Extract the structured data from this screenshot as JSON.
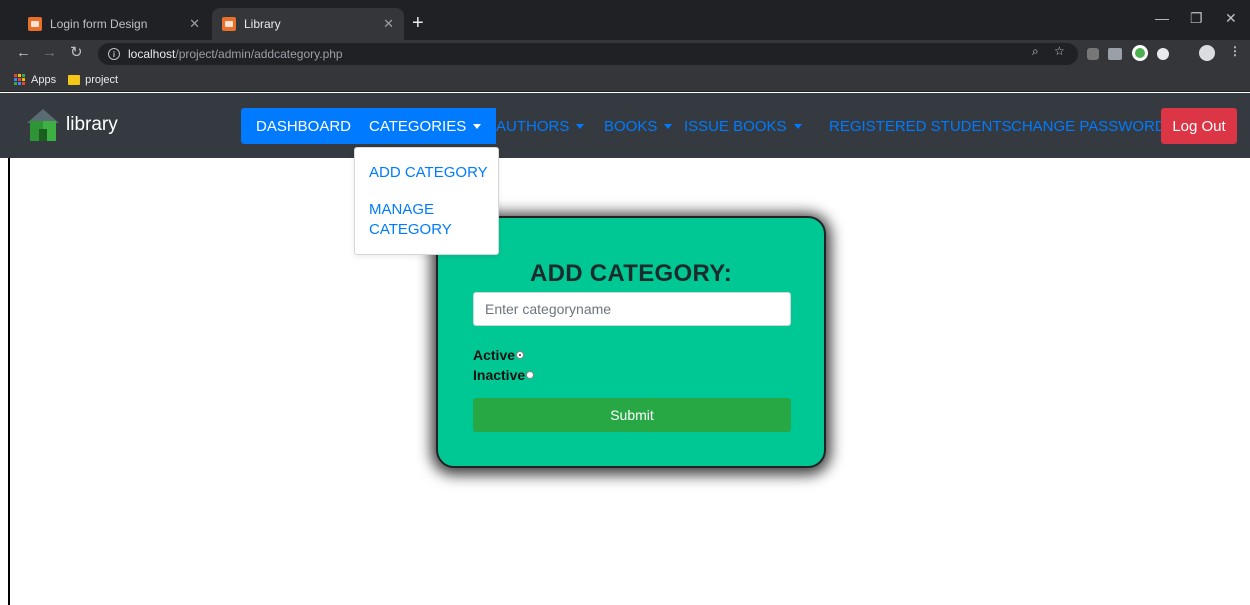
{
  "browser": {
    "tabs": [
      {
        "title": "Login form Design",
        "active": false
      },
      {
        "title": "Library",
        "active": true
      }
    ],
    "new_tab_label": "+",
    "url_host": "localhost",
    "url_path": "/project/admin/addcategory.php",
    "bookmarks": [
      {
        "label": "Apps",
        "icon": "apps-grid-icon"
      },
      {
        "label": "project",
        "icon": "folder-icon"
      }
    ]
  },
  "navbar": {
    "brand": "library",
    "links": [
      {
        "label": "DASHBOARD"
      },
      {
        "label": "CATEGORIES"
      },
      {
        "label": "AUTHORS"
      },
      {
        "label": "BOOKS"
      },
      {
        "label": "ISSUE BOOKS"
      },
      {
        "label": "REGISTERED STUDENTS"
      },
      {
        "label": "CHANGE PASSWORD"
      }
    ],
    "logout": "Log Out"
  },
  "dropdown": {
    "items": [
      "ADD CATEGORY",
      "MANAGE CATEGORY"
    ]
  },
  "form": {
    "title": "ADD CATEGORY:",
    "input_placeholder": "Enter categoryname",
    "status_options": [
      {
        "label": "Active",
        "checked": true
      },
      {
        "label": "Inactive",
        "checked": false
      }
    ],
    "submit_label": "Submit"
  },
  "colors": {
    "primary": "#007bff",
    "danger": "#dc3545",
    "success": "#28a745",
    "card": "#00c894",
    "navbar": "#343a40"
  }
}
